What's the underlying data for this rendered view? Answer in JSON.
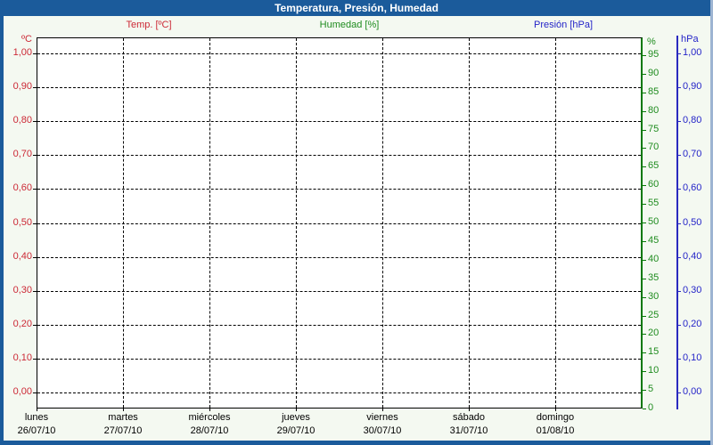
{
  "window": {
    "title": "Temperatura, Presión, Humedad",
    "titlebar_color": "#1b5b9b",
    "border_color": "#1b5b9b",
    "right_border_color": "#9db4d2",
    "background_color": "#f4f9f1",
    "plot_background": "#ffffff",
    "grid_color": "#000000"
  },
  "legend": [
    {
      "id": "temp",
      "label": "Temp. [ºC]",
      "color": "#cc2936"
    },
    {
      "id": "humidity",
      "label": "Humedad [%]",
      "color": "#1f8c1f"
    },
    {
      "id": "pressure",
      "label": "Presión [hPa]",
      "color": "#2424c8"
    }
  ],
  "chart_data": {
    "type": "line",
    "title": "Temperatura, Presión, Humedad",
    "grid": {
      "horizontal": "dashed",
      "vertical": "dashed",
      "plot_empty": true
    },
    "x_axis": {
      "days": [
        {
          "name": "lunes",
          "date": "26/07/10"
        },
        {
          "name": "martes",
          "date": "27/07/10"
        },
        {
          "name": "miércoles",
          "date": "28/07/10"
        },
        {
          "name": "jueves",
          "date": "29/07/10"
        },
        {
          "name": "viernes",
          "date": "30/07/10"
        },
        {
          "name": "sábado",
          "date": "31/07/10"
        },
        {
          "name": "domingo",
          "date": "01/08/10"
        }
      ]
    },
    "axes": {
      "temp": {
        "title": "ºC",
        "side": "left",
        "color": "#cc2936",
        "line_color": "#000000",
        "range": [
          0,
          1
        ],
        "tick_labels": [
          "1,00",
          "0,90",
          "0,80",
          "0,70",
          "0,60",
          "0,50",
          "0,40",
          "0,30",
          "0,20",
          "0,10",
          "0,00"
        ]
      },
      "humidity": {
        "title": "%",
        "side": "right-inner",
        "color": "#1f8c1f",
        "line_color": "#067806",
        "range": [
          0,
          100
        ],
        "tick_labels": [
          "95",
          "90",
          "85",
          "80",
          "75",
          "70",
          "65",
          "60",
          "55",
          "50",
          "45",
          "40",
          "35",
          "30",
          "25",
          "20",
          "15",
          "10",
          "5",
          "0"
        ]
      },
      "pressure": {
        "title": "hPa",
        "side": "right-outer",
        "color": "#2424c8",
        "line_color": "#2a2abf",
        "range": [
          0,
          1
        ],
        "tick_labels": [
          "1,00",
          "0,90",
          "0,80",
          "0,70",
          "0,60",
          "0,50",
          "0,40",
          "0,30",
          "0,20",
          "0,10",
          "0,00"
        ]
      }
    },
    "series": [
      {
        "name": "Temp. [ºC]",
        "axis": "temp",
        "color": "#cc2936",
        "values": []
      },
      {
        "name": "Humedad [%]",
        "axis": "humidity",
        "color": "#1f8c1f",
        "values": []
      },
      {
        "name": "Presión [hPa]",
        "axis": "pressure",
        "color": "#2424c8",
        "values": []
      }
    ]
  }
}
